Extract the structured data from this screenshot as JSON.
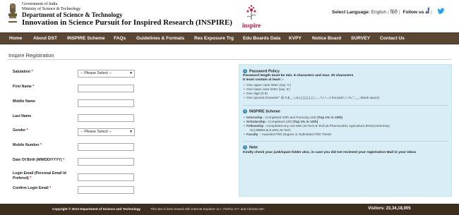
{
  "header": {
    "gov_line": "Government of India",
    "ministry_line": "Ministry of Science & Technology",
    "dept_line": "Department of Science & Technology",
    "program_line": "Innovation in Science Pursuit for Inspired Research (INSPIRE)",
    "logo_word": "inspire",
    "select_language_label": "Select Language:",
    "lang_english": "English",
    "lang_hindi": "हिंदी",
    "follow_us_label": "Follow us at :",
    "facebook_glyph": "f"
  },
  "nav": {
    "items": [
      "Home",
      "About DST",
      "INSPIRE Scheme",
      "FAQs",
      "Guidelines & Formats",
      "Res Exposure Trg",
      "Edu Boards Data",
      "KVPY",
      "Notice Board",
      "SURVEY",
      "Contact Us"
    ]
  },
  "page_title": "Inspire Registration",
  "form": {
    "salutation_label": "Salutation",
    "salutation_value": "-- Please Select --",
    "first_name_label": "First Name",
    "middle_name_label": "Middle Name",
    "last_name_label": "Last Name",
    "gender_label": "Gender",
    "gender_value": "-- Please Select --",
    "mobile_label": "Mobile Number",
    "dob_label": "Date Of Birth (MM/DD/YYYY)",
    "login_email_label_1": "Login Email (Personal Email Id",
    "login_email_label_2": "Prefered)",
    "confirm_email_label": "Confirm Login Email",
    "required_mark": "*"
  },
  "info": {
    "password_policy_head": "Password Policy",
    "pp_line1": "Password length must be min. 8 characters and max. 20 characters",
    "pp_line2": "It must contain at least :-",
    "pp_bullets": [
      "One upper case letter (say 'A')",
      "One lower case letter (say 'a')",
      "One digit (0-9)",
      "One special character\" @,#,$,_-,!,&,(,),[,],{,},|,\\,;,:,.,?,/,+,=) Except(<,>,%,\",',_,;,blank space)"
    ],
    "scheme_head": "INSPIRE Scheme",
    "scheme_items": [
      {
        "name": "Internship",
        "text": " :-Completed 10th and Pursuing 11th ",
        "bold": "(Top 1% in 10th)"
      },
      {
        "name": "Scholarship",
        "text": " :-Completed 12th ",
        "bold": "(Top 1% in 12th)"
      },
      {
        "name": "Fellowship",
        "text": " :-Completed any one MSc,M.Tech,B.Tech,B.Pharma,BSc Agriculture,BVSc(Veterinary",
        "bold": ""
      },
      {
        "name": "",
        "text": "Sc),MBBS,B.E,MSc,M.Tech",
        "bold": ""
      },
      {
        "name": "Faculty",
        "text": " :- Awarded PhD Degree or Submitted PhD Thesis",
        "bold": ""
      }
    ],
    "note_head": "Note",
    "note_text": "Kindly check your junk/spam folder also, in case you did not recieved your registration Mail in your inbox"
  },
  "footer": {
    "copyright": "Copyright © 2013 Department of Science and Technology",
    "browser_note": "This site is best viewed with Internet Explorer 11+, Firefox 27+ and Chrome 58+",
    "visitors": "Visitors: 23,34,18,005"
  },
  "colors": {
    "nav_bg": "#5a4632",
    "footer_bg": "#3d2d1e",
    "info_bg": "#d9edf7",
    "required": "#dd0000",
    "brand_magenta": "#b0164a"
  }
}
